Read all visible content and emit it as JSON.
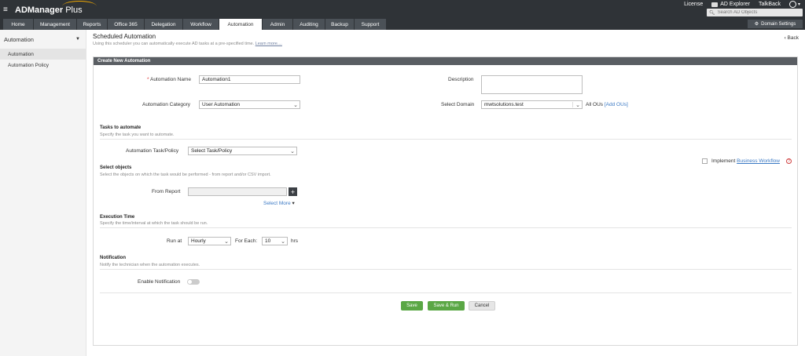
{
  "header": {
    "logo": "ADManager",
    "logo_plus": "Plus",
    "links": {
      "license": "License",
      "ad_explorer": "AD Explorer",
      "talkback": "TalkBack"
    },
    "search_placeholder": "Search AD Objects",
    "tabs": [
      {
        "label": "Home"
      },
      {
        "label": "Management"
      },
      {
        "label": "Reports"
      },
      {
        "label": "Office 365"
      },
      {
        "label": "Delegation"
      },
      {
        "label": "Workflow"
      },
      {
        "label": "Automation"
      },
      {
        "label": "Admin"
      },
      {
        "label": "Auditing"
      },
      {
        "label": "Backup"
      },
      {
        "label": "Support"
      }
    ],
    "active_tab": "Automation",
    "domain_settings": "Domain Settings"
  },
  "sidebar": {
    "title": "Automation",
    "items": [
      {
        "label": "Automation"
      },
      {
        "label": "Automation Policy"
      }
    ]
  },
  "page": {
    "title": "Scheduled Automation",
    "description": "Using this scheduler you can automatically execute AD tasks at a pre-specified time.",
    "learn_more": "Learn more....",
    "back": "Back"
  },
  "form": {
    "panel_title": "Create New Automation",
    "automation_name_label": "Automation Name",
    "automation_name_value": "Automation1",
    "description_label": "Description",
    "category_label": "Automation Category",
    "category_value": "User Automation",
    "domain_label": "Select Domain",
    "domain_value": "mwtsolutions.test",
    "all_ous": "All OUs",
    "add_ous": "[Add OUs]",
    "tasks_title": "Tasks to automate",
    "tasks_desc": "Specify the task you want to automate.",
    "task_policy_label": "Automation Task/Policy",
    "task_policy_value": "Select Task/Policy",
    "implement_label": "Implement",
    "business_workflow": "Business Workflow",
    "objects_title": "Select objects",
    "objects_desc": "Select the objects on which the task would be performed - from report and/or CSV import.",
    "from_report_label": "From Report",
    "select_more": "Select More",
    "exec_title": "Execution Time",
    "exec_desc": "Specify the time/interval at which the task should be run.",
    "run_at_label": "Run at",
    "run_at_value": "Hourly",
    "for_each_label": "For Each:",
    "for_each_value": "10",
    "hrs": "hrs",
    "notification_title": "Notification",
    "notification_desc": "Notify the technician when the automation executes.",
    "enable_notification_label": "Enable Notification",
    "enable_notification_on": false
  },
  "buttons": {
    "save": "Save",
    "save_run": "Save & Run",
    "cancel": "Cancel"
  },
  "colors": {
    "topbar": "#2f3337",
    "tab": "#4b5157",
    "accent_green": "#5aa745",
    "link_blue": "#3b79c4"
  }
}
